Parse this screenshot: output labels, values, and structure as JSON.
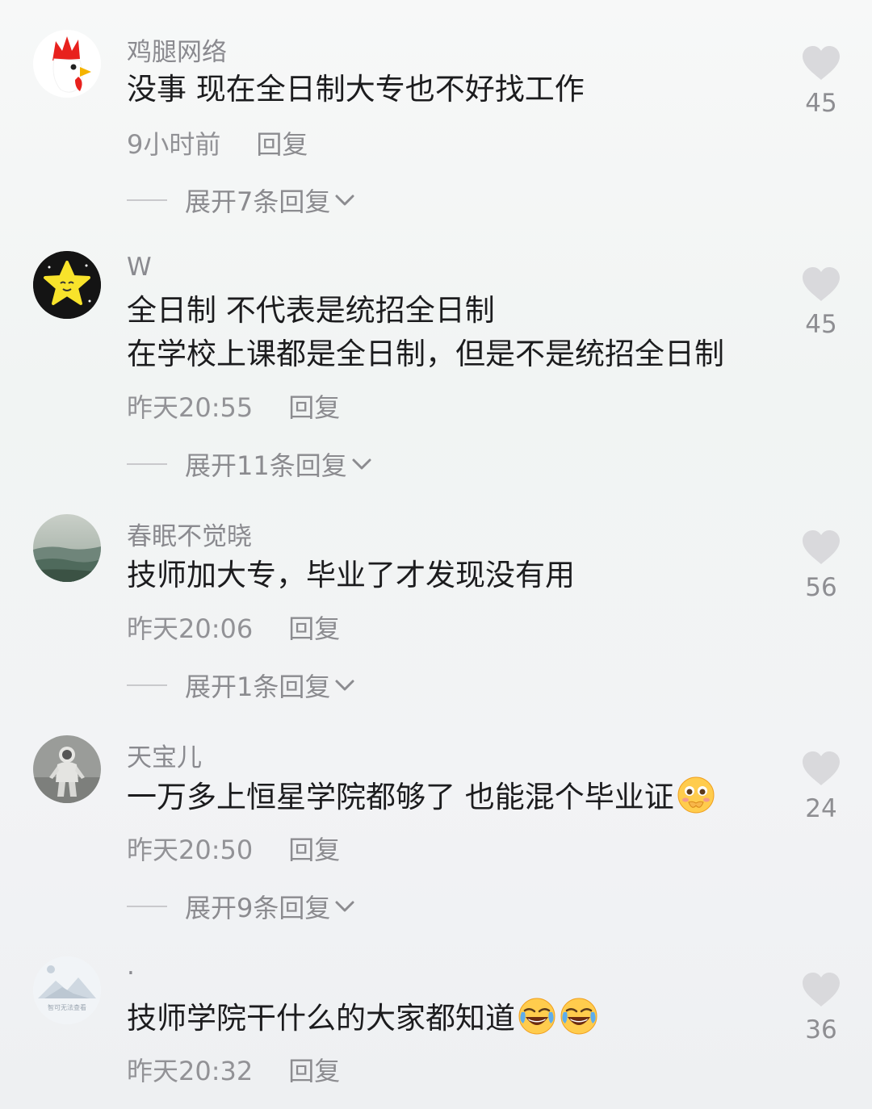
{
  "comments": [
    {
      "username": "鸡腿网络",
      "text": [
        "没事 现在全日制大专也不好找工作"
      ],
      "time": "9小时前",
      "reply_label": "回复",
      "expand_label": "展开7条回复",
      "likes": "45",
      "avatar_icon": "rooster-avatar-icon"
    },
    {
      "username": "W",
      "text": [
        "全日制 不代表是统招全日制",
        "在学校上课都是全日制，但是不是统招全日制"
      ],
      "time": "昨天20:55",
      "reply_label": "回复",
      "expand_label": "展开11条回复",
      "likes": "45",
      "avatar_icon": "star-avatar-icon"
    },
    {
      "username": "春眠不觉晓",
      "text": [
        "技师加大专，毕业了才发现没有用"
      ],
      "time": "昨天20:06",
      "reply_label": "回复",
      "expand_label": "展开1条回复",
      "likes": "56",
      "avatar_icon": "seascape-avatar-icon"
    },
    {
      "username": "天宝儿",
      "text": [
        "一万多上恒星学院都够了 也能混个毕业证"
      ],
      "time": "昨天20:50",
      "reply_label": "回复",
      "expand_label": "展开9条回复",
      "likes": "24",
      "avatar_icon": "astronaut-avatar-icon",
      "emojis": [
        "blush-emoji-icon"
      ]
    },
    {
      "username": "·",
      "text": [
        "技师学院干什么的大家都知道"
      ],
      "time": "昨天20:32",
      "reply_label": "回复",
      "likes": "36",
      "avatar_icon": "mountain-avatar-icon",
      "avatar_caption": "智可无法查看",
      "emojis": [
        "rofl-emoji-icon",
        "rofl-emoji-icon"
      ]
    }
  ],
  "colors": {
    "like_heart": "#d9d9dc",
    "secondary_text": "#8a8a8f",
    "primary_text": "#1c1c1e"
  }
}
